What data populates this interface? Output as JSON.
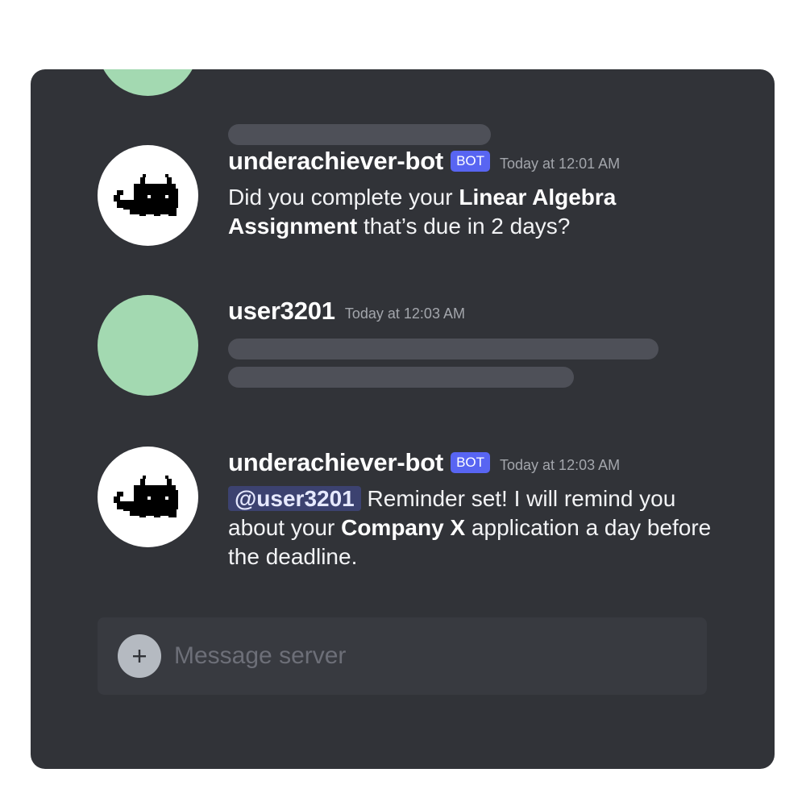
{
  "messages": [
    {
      "username": "underachiever-bot",
      "badge": "BOT",
      "timestamp": "Today at 12:01 AM",
      "text": {
        "p1": "Did you complete your ",
        "b1": "Linear Algebra Assignment",
        "p2": " that’s due in 2 days?"
      }
    },
    {
      "username": "user3201",
      "timestamp": "Today at 12:03 AM"
    },
    {
      "username": "underachiever-bot",
      "badge": "BOT",
      "timestamp": "Today at 12:03 AM",
      "text": {
        "mention": "@user3201",
        "p1": " Reminder set! I will remind you about your ",
        "b1": "Company X",
        "p2": " application a day before the deadline."
      }
    }
  ],
  "composer": {
    "placeholder": "Message server",
    "add_icon": "plus-icon"
  },
  "colors": {
    "background": "#313338",
    "bot_badge": "#5865f2",
    "user_avatar": "#a3d9b1",
    "mention_bg": "#3c4270"
  }
}
